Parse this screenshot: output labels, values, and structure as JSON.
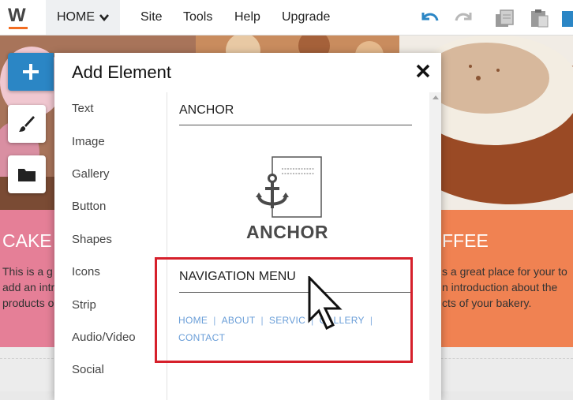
{
  "topbar": {
    "logo_letter": "W",
    "home_label": "HOME",
    "menu": [
      "Site",
      "Tools",
      "Help",
      "Upgrade"
    ],
    "icons": [
      "undo-icon",
      "redo-icon",
      "copy-page-icon",
      "paste-page-icon",
      "publish-icon"
    ]
  },
  "site": {
    "left_card": {
      "title": "CAKE",
      "body": [
        "This is a g",
        "add an intr",
        "products o"
      ],
      "color": "#e57f97"
    },
    "right_card": {
      "title": "FFEE",
      "body": [
        "s a great place for your to",
        "n introduction about the",
        "cts of your bakery."
      ],
      "color": "#f08252"
    }
  },
  "tools": [
    "add-icon",
    "paintbrush-icon",
    "folder-icon"
  ],
  "panel": {
    "title": "Add Element",
    "categories": [
      "Text",
      "Image",
      "Gallery",
      "Button",
      "Shapes",
      "Icons",
      "Strip",
      "Audio/Video",
      "Social"
    ],
    "sections": [
      {
        "heading": "ANCHOR",
        "preview_label": "ANCHOR"
      },
      {
        "heading": "NAVIGATION MENU",
        "links": [
          "HOME",
          "ABOUT",
          "SERVIC",
          "GALLERY",
          "CONTACT"
        ]
      }
    ]
  },
  "colors": {
    "accent": "#2b86c5",
    "highlight": "#d6202b",
    "brand_orange": "#f26d21",
    "link_blue": "#6a9ed8"
  }
}
